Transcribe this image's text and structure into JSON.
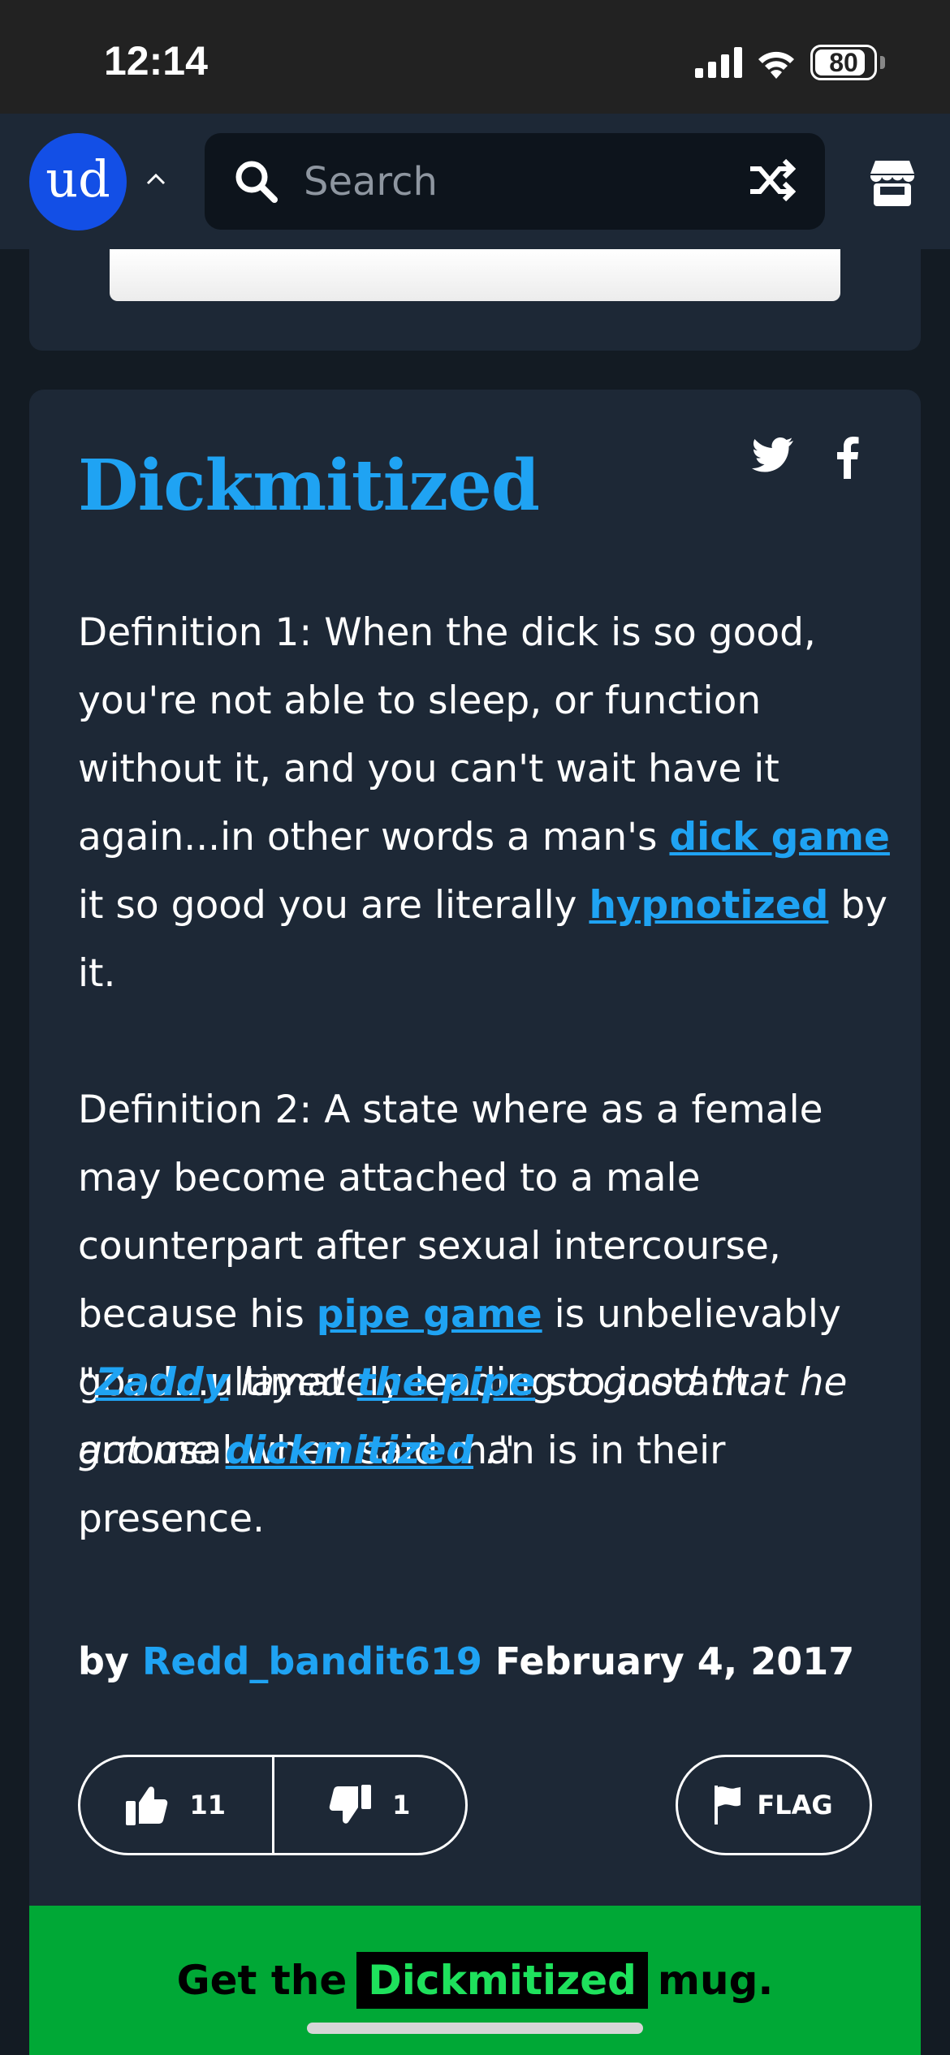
{
  "status_bar": {
    "time": "12:14",
    "battery": "80"
  },
  "nav": {
    "logo_text": "ud",
    "search_placeholder": "Search"
  },
  "entry": {
    "word": "Dickmitized",
    "definition_1": {
      "before": "Definition 1: When the dick is so good, you're not able to sleep, or function without it, and you can't wait have it again...in other words a man's ",
      "link1": "dick game",
      "middle": " it so good you are literally ",
      "link2": "hypnotized",
      "after": " by it."
    },
    "definition_2": {
      "before": "Definition 2: A state where as a female may become attached to a male counterpart after sexual intercourse, because his ",
      "link": "pipe game",
      "after": " is unbelievably good...ultimately leading to instant arrousal when said man is in their presence."
    },
    "example": {
      "quote_open": "\"",
      "link1": "Zaddy",
      "text1": " layed ",
      "link2": "the pipe",
      "text2": " so good that he got me ",
      "link3": "dickmitized",
      "quote_close": " .\""
    },
    "by_label": "by",
    "author": "Redd_bandit619",
    "date": "February 4, 2017",
    "upvotes": "11",
    "downvotes": "1",
    "flag_label": "FLAG"
  },
  "mug_banner": {
    "prefix": "Get the",
    "word": "Dickmitized",
    "suffix": "mug."
  },
  "colors": {
    "accent": "#1fa3f3",
    "card": "#1d2836",
    "background": "#131b23",
    "logo": "#134fe6",
    "mug_green": "#00a836"
  },
  "icons": [
    "search-icon",
    "shuffle-icon",
    "store-icon",
    "chevron-up-icon",
    "twitter-icon",
    "facebook-icon",
    "thumbs-up-icon",
    "thumbs-down-icon",
    "flag-icon",
    "signal-icon",
    "wifi-icon",
    "battery-icon"
  ]
}
